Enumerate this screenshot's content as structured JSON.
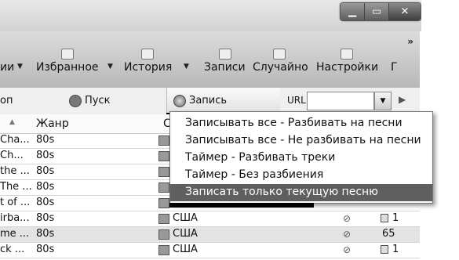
{
  "toolbar": {
    "items": [
      "ии",
      "Избранное",
      "История",
      "Записи",
      "Случайно",
      "Настройки",
      "Г"
    ],
    "more": "»"
  },
  "controls": {
    "stop_partial": "оп",
    "play": "Пуск",
    "record": "Запись",
    "url_label": "URL",
    "url_value": ""
  },
  "columns": {
    "genre": "Жанр",
    "col3": "С"
  },
  "rows": [
    {
      "title": "Cha...",
      "genre": "80s",
      "country": "",
      "num": ""
    },
    {
      "title": "Ch...",
      "genre": "80s",
      "country": "",
      "num": ""
    },
    {
      "title": "the ...",
      "genre": "80s",
      "country": "",
      "num": ""
    },
    {
      "title": "The ...",
      "genre": "80s",
      "country": "",
      "num": ""
    },
    {
      "title": "t of ...",
      "genre": "80s",
      "country": "",
      "num": ""
    },
    {
      "title": "irba...",
      "genre": "80s",
      "country": "США",
      "num": "1"
    },
    {
      "title": "me ...",
      "genre": "80s",
      "country": "США",
      "num": "65"
    },
    {
      "title": "ck ...",
      "genre": "80s",
      "country": "США",
      "num": "1"
    }
  ],
  "menu": {
    "items": [
      "Записывать все - Разбивать на песни",
      "Записывать все - Не разбивать на песни",
      "Таймер - Разбивать треки",
      "Таймер - Без разбиения",
      "Записать только текущую песню"
    ],
    "highlighted_index": 4
  },
  "colors": {
    "highlight": "#5f5f5f",
    "toolbar": "#c8c8c8",
    "selected_row": "#e3e3e3"
  }
}
